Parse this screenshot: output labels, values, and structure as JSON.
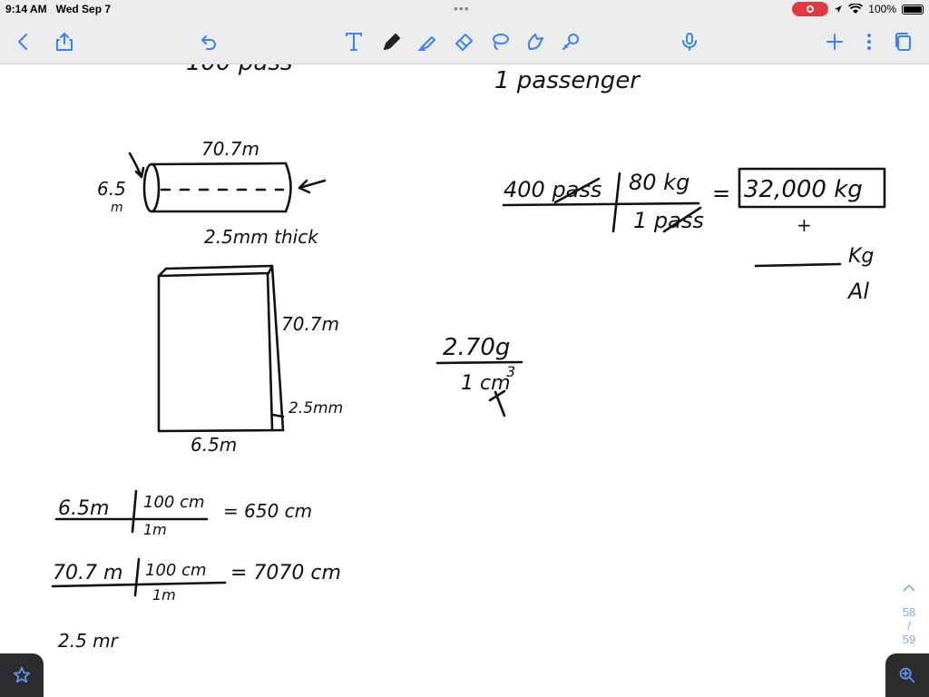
{
  "status": {
    "time": "9:14 AM",
    "date": "Wed Sep 7",
    "battery": "100%",
    "record_color": "#e0393e"
  },
  "toolbar": {
    "accent": "#3a82f7",
    "icons": [
      "back-icon",
      "share-icon",
      "undo-icon",
      "text-tool-icon",
      "pen-icon",
      "highlighter-icon",
      "eraser-icon",
      "lasso-icon",
      "shapes-icon",
      "laser-pointer-icon",
      "microphone-icon",
      "add-icon",
      "more-icon",
      "pages-icon"
    ]
  },
  "notes": {
    "top_left_partial": "100 pass",
    "top_right_partial": "1 passenger",
    "cylinder_length": "70.7m",
    "cylinder_diameter_top": "6.5",
    "cylinder_diameter_bottom": "m",
    "cylinder_thickness": "2.5mm thick",
    "calc_numerator_1": "400 pass",
    "calc_numerator_2": "80 kg",
    "calc_denominator": "1 pass",
    "calc_equals": "=",
    "calc_result": "32,000 kg",
    "plus_sign": "+",
    "blank_kg": "Kg",
    "al_label": "Al",
    "sheet_height": "70.7m",
    "sheet_thickness": "2.5mm",
    "sheet_width": "6.5m",
    "density_top": "2.70g",
    "density_bottom": "1 cm",
    "density_exp": "3",
    "conv1_left": "6.5m",
    "conv1_top": "100 cm",
    "conv1_bottom": "1m",
    "conv1_result": "= 650 cm",
    "conv2_left": "70.7 m",
    "conv2_top": "100 cm",
    "conv2_bottom": "1m",
    "conv2_result": "= 7070 cm",
    "conv3_left": "2.5 mr"
  },
  "pager": {
    "current": "58",
    "separator": "/",
    "total": "59"
  }
}
